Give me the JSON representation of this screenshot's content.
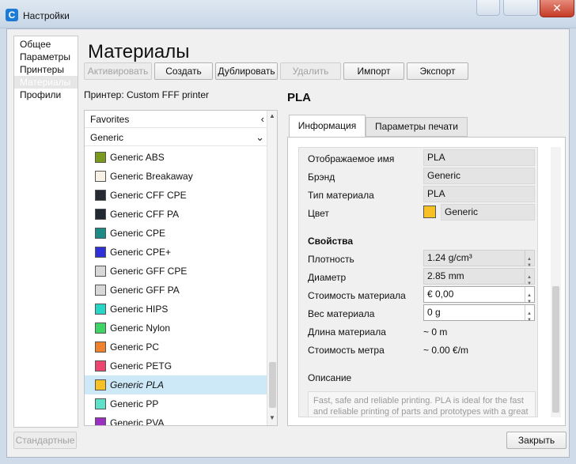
{
  "window": {
    "title": "Настройки",
    "app_icon": "C",
    "close_glyph": "✕"
  },
  "nav": {
    "items": [
      {
        "label": "Общее",
        "selected": false
      },
      {
        "label": "Параметры",
        "selected": false
      },
      {
        "label": "Принтеры",
        "selected": false
      },
      {
        "label": "Материалы",
        "selected": true
      },
      {
        "label": "Профили",
        "selected": false
      }
    ]
  },
  "page": {
    "heading": "Материалы"
  },
  "toolbar": {
    "activate": "Активировать",
    "create": "Создать",
    "duplicate": "Дублировать",
    "delete": "Удалить",
    "import": "Импорт",
    "export": "Экспорт"
  },
  "printer": {
    "label": "Принтер: Custom FFF printer"
  },
  "material_list": {
    "favorites": "Favorites",
    "favorites_chevron": "‹",
    "generic": "Generic",
    "generic_chevron": "⌄",
    "items": [
      {
        "name": "Generic ABS",
        "color": "#7a9a1e"
      },
      {
        "name": "Generic Breakaway",
        "color": "#f7f1e6"
      },
      {
        "name": "Generic CFF CPE",
        "color": "#252a33"
      },
      {
        "name": "Generic CFF PA",
        "color": "#222831"
      },
      {
        "name": "Generic CPE",
        "color": "#1c8a86"
      },
      {
        "name": "Generic CPE+",
        "color": "#3030d8"
      },
      {
        "name": "Generic GFF CPE",
        "color": "#d8d8d8"
      },
      {
        "name": "Generic GFF PA",
        "color": "#d8d8d8"
      },
      {
        "name": "Generic HIPS",
        "color": "#27d6c4"
      },
      {
        "name": "Generic Nylon",
        "color": "#3fd466"
      },
      {
        "name": "Generic PC",
        "color": "#f0822e"
      },
      {
        "name": "Generic PETG",
        "color": "#ee4470"
      },
      {
        "name": "Generic PLA",
        "color": "#f7c125",
        "selected": true
      },
      {
        "name": "Generic PP",
        "color": "#5ee0c9"
      },
      {
        "name": "Generic PVA",
        "color": "#9b2fbf"
      }
    ]
  },
  "detail": {
    "title": "PLA",
    "tabs": [
      "Информация",
      "Параметры печати"
    ],
    "info": {
      "display_name_label": "Отображаемое имя",
      "display_name": "PLA",
      "brand_label": "Брэнд",
      "brand": "Generic",
      "type_label": "Тип материала",
      "type": "PLA",
      "color_label": "Цвет",
      "color_name": "Generic",
      "color_hex": "#f7c125"
    },
    "properties": {
      "heading": "Свойства",
      "density_label": "Плотность",
      "density": "1.24 g/cm³",
      "diameter_label": "Диаметр",
      "diameter": "2.85 mm",
      "cost_label": "Стоимость материала",
      "cost": "€ 0,00",
      "weight_label": "Вес материала",
      "weight": "0 g",
      "length_label": "Длина материала",
      "length": "~ 0 m",
      "cost_per_meter_label": "Стоимость метра",
      "cost_per_meter": "~ 0.00 €/m"
    },
    "description": {
      "label": "Описание",
      "text": "Fast, safe and reliable printing. PLA is ideal for the fast and reliable printing of parts and prototypes with a great surface quality."
    }
  },
  "footer": {
    "defaults": "Стандартные",
    "close": "Закрыть"
  }
}
